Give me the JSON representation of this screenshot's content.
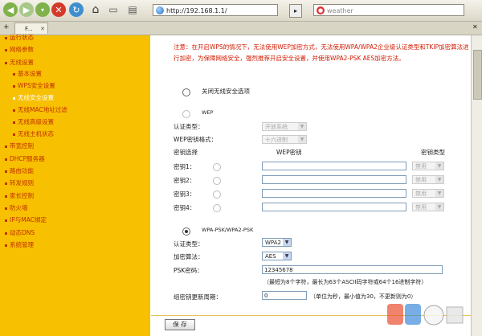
{
  "browser": {
    "address": "http://192.168.1.1/",
    "search_placeholder": "weather",
    "tab_label": "F..."
  },
  "sidebar": {
    "items": [
      {
        "label": "运行状态",
        "sub": false
      },
      {
        "label": "网络参数",
        "sub": false
      },
      {
        "label": "无线设置",
        "sub": false
      },
      {
        "label": "基本设置",
        "sub": true
      },
      {
        "label": "WPS安全设置",
        "sub": true
      },
      {
        "label": "无线安全设置",
        "sub": true,
        "active": true
      },
      {
        "label": "无线MAC地址过滤",
        "sub": true
      },
      {
        "label": "无线高级设置",
        "sub": true
      },
      {
        "label": "无线主机状态",
        "sub": true
      },
      {
        "label": "带宽控制",
        "sub": false
      },
      {
        "label": "DHCP服务器",
        "sub": false
      },
      {
        "label": "路由功能",
        "sub": false
      },
      {
        "label": "转发规则",
        "sub": false
      },
      {
        "label": "家长控制",
        "sub": false
      },
      {
        "label": "防火墙",
        "sub": false
      },
      {
        "label": "IP与MAC绑定",
        "sub": false
      },
      {
        "label": "动态DNS",
        "sub": false
      },
      {
        "label": "系统管理",
        "sub": false
      }
    ]
  },
  "content": {
    "note": "注意：在开启WPS的情况下，无法使用WEP加密方式，无法使用WPA/WPA2企业级认证类型和TKIP加密算法进行加密，为保障网络安全，强烈推荐开启安全设置，并使用WPA2-PSK AES加密方法。",
    "disable_label": "关闭无线安全选项",
    "wep": {
      "title": "WEP",
      "auth_label": "认证类型：",
      "auth_value": "开放系统",
      "format_label": "WEP密钥格式：",
      "format_value": "十六进制",
      "col_select": "密钥选择",
      "col_key": "WEP密钥",
      "col_type": "密钥类型",
      "keys": [
        {
          "label": "密钥1：",
          "type": "禁用"
        },
        {
          "label": "密钥2：",
          "type": "禁用"
        },
        {
          "label": "密钥3：",
          "type": "禁用"
        },
        {
          "label": "密钥4：",
          "type": "禁用"
        }
      ]
    },
    "wpa": {
      "title": "WPA-PSK/WPA2-PSK",
      "auth_label": "认证类型：",
      "auth_value": "WPA2",
      "enc_label": "加密算法：",
      "enc_value": "AES",
      "psk_label": "PSK密码：",
      "psk_value": "12345678",
      "psk_hint": "（最短为8个字符，最长为63个ASCII码字符或64个16进制字符）",
      "period_label": "组密钥更新周期：",
      "period_value": "0",
      "period_hint": "（单位为秒，最小值为30，不更新则为0）"
    },
    "save_label": "保 存"
  }
}
